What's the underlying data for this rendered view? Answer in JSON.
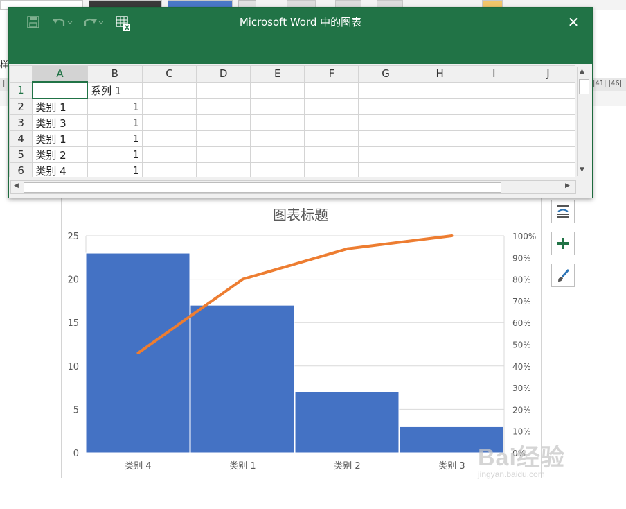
{
  "window": {
    "title": "Microsoft Word 中的图表",
    "close_glyph": "✕"
  },
  "background": {
    "left_fragment": "样",
    "ruler_right": "|41| |46|"
  },
  "sheet": {
    "columns": [
      "A",
      "B",
      "C",
      "D",
      "E",
      "F",
      "G",
      "H",
      "I",
      "J"
    ],
    "rows": [
      {
        "num": "1",
        "a": "",
        "b": "系列 1"
      },
      {
        "num": "2",
        "a": "类别 1",
        "b": "1"
      },
      {
        "num": "3",
        "a": "类别 3",
        "b": "1"
      },
      {
        "num": "4",
        "a": "类别 1",
        "b": "1"
      },
      {
        "num": "5",
        "a": "类别 2",
        "b": "1"
      },
      {
        "num": "6",
        "a": "类别 4",
        "b": "1"
      }
    ]
  },
  "chart_data": {
    "type": "bar",
    "title": "图表标题",
    "categories": [
      "类别 4",
      "类别 1",
      "类别 2",
      "类别 3"
    ],
    "series": [
      {
        "type": "bar",
        "values": [
          23,
          17,
          7,
          3
        ],
        "color": "#4472c4"
      },
      {
        "type": "line",
        "values": [
          0.46,
          0.8,
          0.94,
          1.0
        ],
        "color": "#ed7d31",
        "axis": "secondary"
      }
    ],
    "ylim": [
      0,
      25
    ],
    "yticks": [
      "0",
      "5",
      "10",
      "15",
      "20",
      "25"
    ],
    "y2lim": [
      0,
      1
    ],
    "y2ticks": [
      "0%",
      "10%",
      "20%",
      "30%",
      "40%",
      "50%",
      "60%",
      "70%",
      "80%",
      "90%",
      "100%"
    ],
    "grid": true,
    "gap_width": 0
  },
  "side_buttons": [
    "chart-layout-icon",
    "chart-elements-plus-icon",
    "chart-styles-brush-icon"
  ],
  "watermark": {
    "line1": "Bai经验",
    "line2": "jingyan.baidu.com"
  }
}
